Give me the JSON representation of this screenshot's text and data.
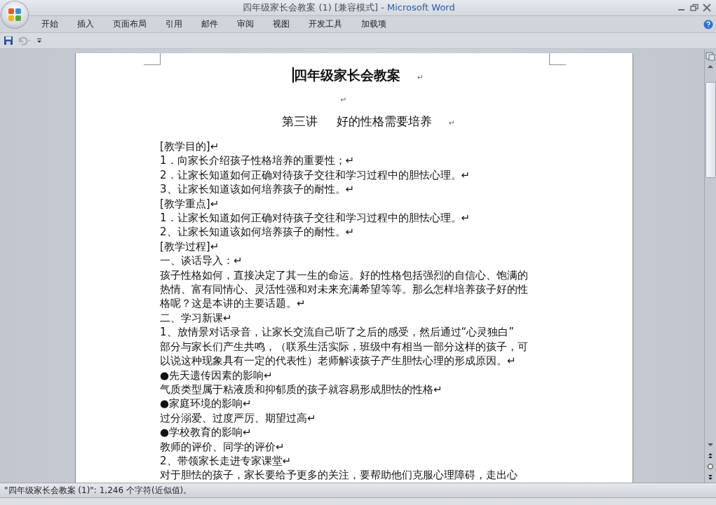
{
  "window": {
    "title": "四年级家长会教案 (1) [兼容模式]",
    "app_name": " - Microsoft Word"
  },
  "ribbon_tabs": [
    {
      "label": "开始",
      "selected": false
    },
    {
      "label": "插入",
      "selected": false
    },
    {
      "label": "页面布局",
      "selected": false
    },
    {
      "label": "引用",
      "selected": false
    },
    {
      "label": "邮件",
      "selected": false
    },
    {
      "label": "审阅",
      "selected": false
    },
    {
      "label": "视图",
      "selected": false
    },
    {
      "label": "开发工具",
      "selected": false
    },
    {
      "label": "加载项",
      "selected": false
    }
  ],
  "document": {
    "paragraphs": [
      {
        "kind": "title",
        "text": "四年级家长会教案",
        "mark": "↵"
      },
      {
        "kind": "empty",
        "mark": "↵"
      },
      {
        "kind": "heading",
        "text": "第三讲     好的性格需要培养",
        "mark": "↵"
      },
      {
        "kind": "body",
        "text": "[教学目的]↵"
      },
      {
        "kind": "body",
        "text": "1．向家长介绍孩子性格培养的重要性；↵"
      },
      {
        "kind": "body",
        "text": "2．让家长知道如何正确对待孩子交往和学习过程中的胆怯心理。↵"
      },
      {
        "kind": "body",
        "text": "3、让家长知道该如何培养孩子的耐性。↵"
      },
      {
        "kind": "body",
        "text": "[教学重点]↵"
      },
      {
        "kind": "body",
        "text": "1．让家长知道如何正确对待孩子交往和学习过程中的胆怯心理。↵"
      },
      {
        "kind": "body",
        "text": "2、让家长知道该如何培养孩子的耐性。↵"
      },
      {
        "kind": "body",
        "text": "[教学过程]↵"
      },
      {
        "kind": "body",
        "text": "一、谈话导入：↵"
      },
      {
        "kind": "body",
        "lines": [
          "孩子性格如何，直接决定了其一生的命运。好的性格包括强烈的自信心、饱满的",
          "热情、富有同情心、灵活性强和对未来充满希望等等。那么怎样培养孩子好的性",
          "格呢？这是本讲的主要话题。↵"
        ]
      },
      {
        "kind": "body",
        "text": "二、学习新课↵"
      },
      {
        "kind": "body",
        "lines": [
          "1、放情景对话录音，让家长交流自己听了之后的感受，然后通过“心灵独白”",
          "部分与家长们产生共鸣，（联系生活实际，班级中有相当一部分这样的孩子，可",
          "以说这种现象具有一定的代表性）老师解读孩子产生胆怯心理的形成原因。↵"
        ]
      },
      {
        "kind": "body",
        "text": "●先天遗传因素的影响↵"
      },
      {
        "kind": "body",
        "text": "气质类型属于粘液质和抑郁质的孩子就容易形成胆怯的性格↵"
      },
      {
        "kind": "body",
        "text": "●家庭环境的影响↵"
      },
      {
        "kind": "body",
        "text": "过分溺爱、过度严厉、期望过高↵"
      },
      {
        "kind": "body",
        "text": "●学校教育的影响↵"
      },
      {
        "kind": "body",
        "text": "教师的评价、同学的评价↵"
      },
      {
        "kind": "body",
        "text": "2、带领家长走进专家课堂↵"
      },
      {
        "kind": "body",
        "text": "对于胆怯的孩子，家长要给予更多的关注，要帮助他们克服心理障碍，走出心"
      }
    ]
  },
  "status_bar": {
    "text": "\"四年级家长会教案 (1)\": 1,246 个字符(近似值)。"
  }
}
